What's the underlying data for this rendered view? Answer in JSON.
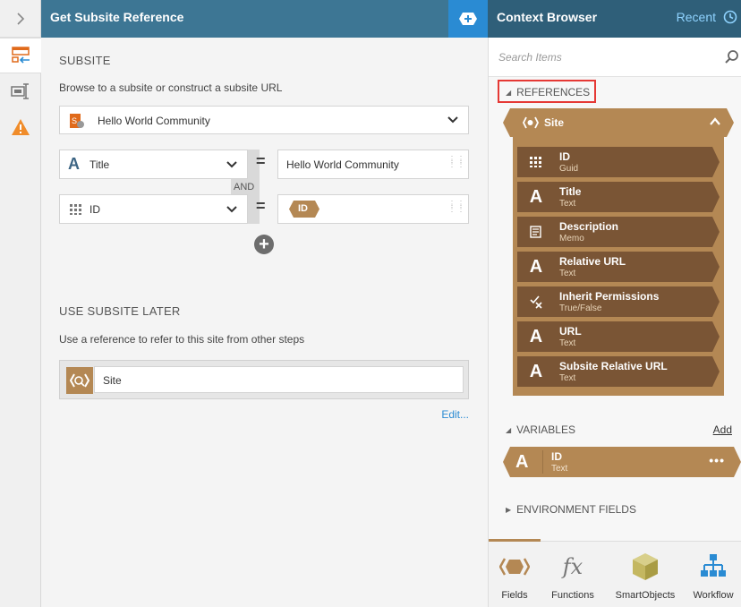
{
  "header": {
    "title": "Get Subsite Reference",
    "context_title": "Context Browser",
    "recent_label": "Recent"
  },
  "subsite": {
    "section_title": "SUBSITE",
    "description": "Browse to a subsite or construct a subsite URL",
    "selected_site": "Hello World Community",
    "rows": [
      {
        "field": "Title",
        "operator": "=",
        "value": "Hello World Community"
      },
      {
        "field": "ID",
        "operator": "=",
        "value_token": "ID"
      }
    ],
    "joiner": "AND"
  },
  "use_later": {
    "section_title": "USE SUBSITE LATER",
    "description": "Use a reference to refer to this site from other steps",
    "reference_value": "Site",
    "edit_label": "Edit..."
  },
  "context": {
    "search_placeholder": "Search Items",
    "references_label": "REFERENCES",
    "site_label": "Site",
    "items": [
      {
        "name": "ID",
        "type": "Guid",
        "icon": "grid-icon"
      },
      {
        "name": "Title",
        "type": "Text",
        "icon": "text-a-icon"
      },
      {
        "name": "Description",
        "type": "Memo",
        "icon": "memo-icon"
      },
      {
        "name": "Relative URL",
        "type": "Text",
        "icon": "text-a-icon"
      },
      {
        "name": "Inherit Permissions",
        "type": "True/False",
        "icon": "check-cross-icon"
      },
      {
        "name": "URL",
        "type": "Text",
        "icon": "text-a-icon"
      },
      {
        "name": "Subsite Relative URL",
        "type": "Text",
        "icon": "text-a-icon"
      }
    ],
    "variables_label": "VARIABLES",
    "add_label": "Add",
    "variable": {
      "name": "ID",
      "type": "Text"
    },
    "env_label": "ENVIRONMENT FIELDS"
  },
  "tabs": [
    {
      "label": "Fields",
      "icon": "fields-icon"
    },
    {
      "label": "Functions",
      "icon": "fx-icon"
    },
    {
      "label": "SmartObjects",
      "icon": "cube-icon"
    },
    {
      "label": "Workflow",
      "icon": "workflow-icon"
    }
  ],
  "colors": {
    "header_blue": "#3d7694",
    "accent_blue": "#2a8bd3",
    "reference_brown": "#b48854",
    "item_brown": "#7a5535",
    "highlight_red": "#e53935"
  }
}
